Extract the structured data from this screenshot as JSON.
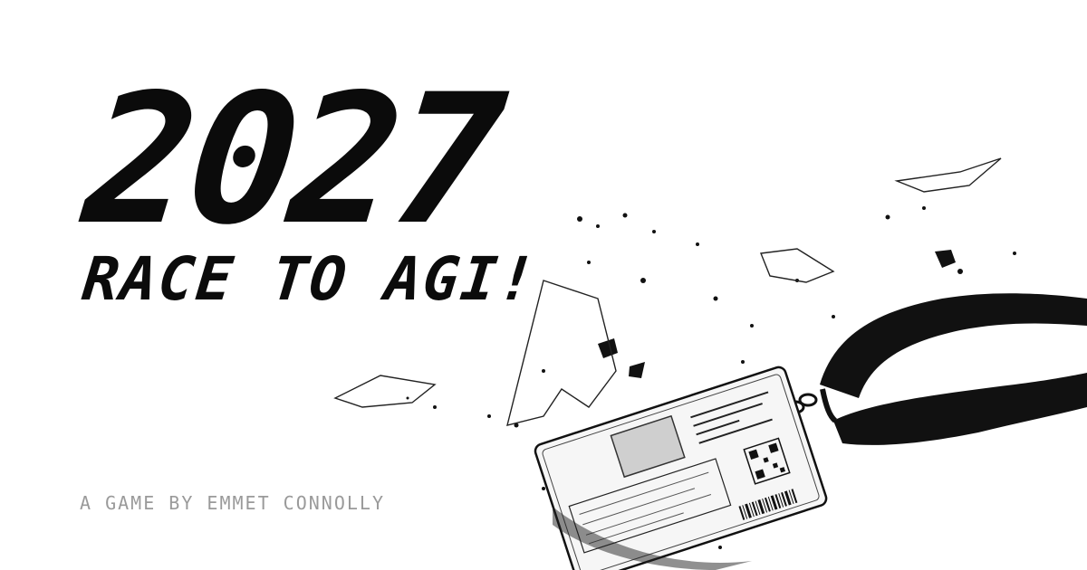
{
  "hero": {
    "year": "2027",
    "tagline": "RACE TO AGI!",
    "credit": "A GAME BY EMMET CONNOLLY"
  },
  "illustration": {
    "subject": "id-badge-on-lanyard",
    "style": "black-and-white ink sketch"
  },
  "colors": {
    "background": "#ffffff",
    "title": "#0b0b0b",
    "credit": "#9a9a9a"
  }
}
